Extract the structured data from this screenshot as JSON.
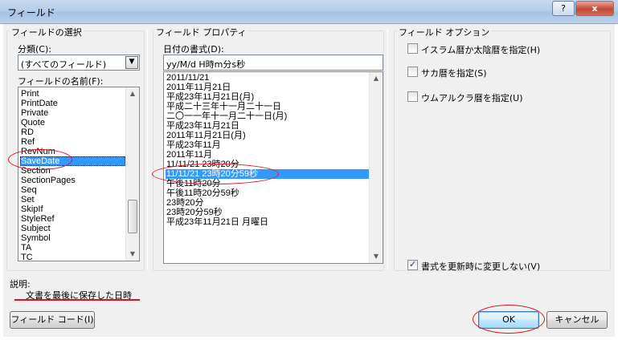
{
  "window": {
    "title": "フィールド",
    "help_label": "?",
    "close_label": "x"
  },
  "field_select": {
    "group_title": "フィールドの選択",
    "category_label": "分類(C):",
    "category_value": "(すべてのフィールド)",
    "names_label": "フィールドの名前(F):",
    "names": [
      "Print",
      "PrintDate",
      "Private",
      "Quote",
      "RD",
      "Ref",
      "RevNum",
      "SaveDate",
      "Section",
      "SectionPages",
      "Seq",
      "Set",
      "SkipIf",
      "StyleRef",
      "Subject",
      "Symbol",
      "TA",
      "TC"
    ],
    "selected_name": "SaveDate"
  },
  "field_props": {
    "group_title": "フィールド プロパティ",
    "format_label": "日付の書式(D):",
    "format_value": "yy/M/d H時m分s秒",
    "formats": [
      "2011/11/21",
      "2011年11月21日",
      "平成23年11月21日(月)",
      "平成二十三年十一月二十一日",
      "二〇一一年十一月二十一日(月)",
      "平成23年11月21日",
      "2011年11月21日(月)",
      "平成23年11月",
      "2011年11月",
      "11/11/21 23時20分",
      "11/11/21 23時20分59秒",
      "午後11時20分",
      "午後11時20分59秒",
      "23時20分",
      "23時20分59秒",
      "平成23年11月21日 月曜日"
    ],
    "selected_format": "11/11/21 23時20分59秒"
  },
  "field_options": {
    "group_title": "フィールド オプション",
    "options": [
      {
        "label": "イスラム暦か太陰暦を指定(H)",
        "checked": false
      },
      {
        "label": "サカ暦を指定(S)",
        "checked": false
      },
      {
        "label": "ウムアルクラ暦を指定(U)",
        "checked": false
      }
    ],
    "preserve_label": "書式を更新時に変更しない(V)",
    "preserve_checked": true
  },
  "description": {
    "label": "説明:",
    "text": "文書を最後に保存した日時"
  },
  "buttons": {
    "field_codes": "フィールド コード(I)",
    "ok": "OK",
    "cancel": "キャンセル"
  },
  "colors": {
    "selection": "#3399ff",
    "annotation": "#e0101e",
    "title_bar": "#b6cde9"
  }
}
